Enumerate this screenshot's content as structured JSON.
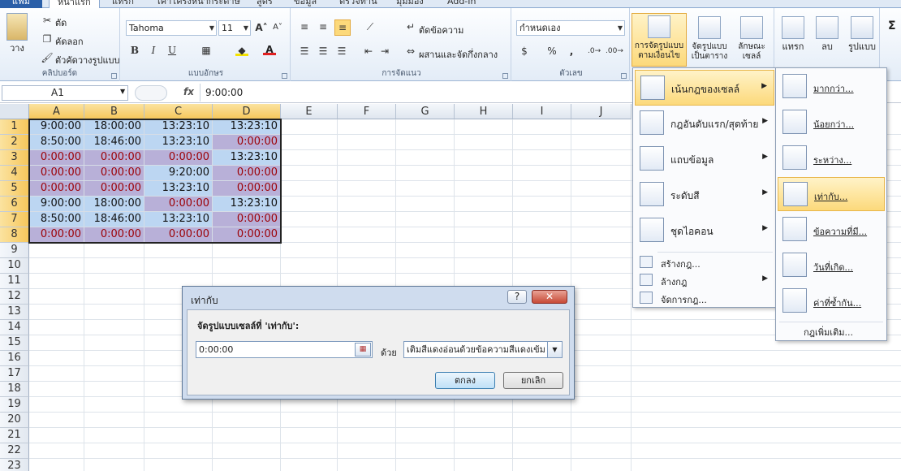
{
  "tabs": {
    "file": "แฟ้ม",
    "home": "หน้าแรก",
    "insert": "แทรก",
    "page_layout": "เค้าโครงหน้ากระดาษ",
    "formulas": "สูตร",
    "data": "ข้อมูล",
    "review": "ตรวจทาน",
    "view": "มุมมอง",
    "addins": "Add-In"
  },
  "ribbon": {
    "clipboard": {
      "title": "คลิปบอร์ด",
      "paste_label": "วาง",
      "cut": "ตัด",
      "copy": "คัดลอก",
      "format_painter": "ตัวคัดวางรูปแบบ"
    },
    "font": {
      "title": "แบบอักษร",
      "font_name": "Tahoma",
      "font_size": "11",
      "bold": "B",
      "italic": "I",
      "underline": "U",
      "font_color_letter": "A"
    },
    "alignment": {
      "title": "การจัดแนว",
      "wrap_text": "ตัดข้อความ",
      "merge_center": "ผสานและจัดกึ่งกลาง"
    },
    "number": {
      "title": "ตัวเลข",
      "format": "กำหนดเอง",
      "percent": "%",
      "comma": ","
    },
    "styles": {
      "conditional_formatting": "การจัดรูปแบบตามเงื่อนไข",
      "format_as_table": "จัดรูปแบบเป็นตาราง",
      "cell_styles": "ลักษณะเซลล์"
    },
    "cells": {
      "insert": "แทรก",
      "delete": "ลบ",
      "format": "รูปแบบ"
    },
    "editing": {
      "sum": "Σ"
    }
  },
  "formula_bar": {
    "name_box": "A1",
    "fx": "fx",
    "formula": "9:00:00"
  },
  "columns": [
    "A",
    "B",
    "C",
    "D",
    "E",
    "F",
    "G",
    "H",
    "I",
    "J"
  ],
  "rows": [
    "1",
    "2",
    "3",
    "4",
    "5",
    "6",
    "7",
    "8",
    "9",
    "10",
    "11",
    "12",
    "13",
    "14",
    "15",
    "16",
    "17",
    "18",
    "19",
    "20",
    "21",
    "22",
    "23"
  ],
  "cells": [
    [
      {
        "v": "9:00:00",
        "red": false
      },
      {
        "v": "18:00:00",
        "red": false
      },
      {
        "v": "13:23:10",
        "red": false
      },
      {
        "v": "13:23:10",
        "red": false
      }
    ],
    [
      {
        "v": "8:50:00",
        "red": false
      },
      {
        "v": "18:46:00",
        "red": false
      },
      {
        "v": "13:23:10",
        "red": false
      },
      {
        "v": "0:00:00",
        "red": true
      }
    ],
    [
      {
        "v": "0:00:00",
        "red": true
      },
      {
        "v": "0:00:00",
        "red": true
      },
      {
        "v": "0:00:00",
        "red": true
      },
      {
        "v": "13:23:10",
        "red": false
      }
    ],
    [
      {
        "v": "0:00:00",
        "red": true
      },
      {
        "v": "0:00:00",
        "red": true
      },
      {
        "v": "9:20:00",
        "red": false
      },
      {
        "v": "0:00:00",
        "red": true
      }
    ],
    [
      {
        "v": "0:00:00",
        "red": true
      },
      {
        "v": "0:00:00",
        "red": true
      },
      {
        "v": "13:23:10",
        "red": false
      },
      {
        "v": "0:00:00",
        "red": true
      }
    ],
    [
      {
        "v": "9:00:00",
        "red": false
      },
      {
        "v": "18:00:00",
        "red": false
      },
      {
        "v": "0:00:00",
        "red": true
      },
      {
        "v": "13:23:10",
        "red": false
      }
    ],
    [
      {
        "v": "8:50:00",
        "red": false
      },
      {
        "v": "18:46:00",
        "red": false
      },
      {
        "v": "13:23:10",
        "red": false
      },
      {
        "v": "0:00:00",
        "red": true
      }
    ],
    [
      {
        "v": "0:00:00",
        "red": true
      },
      {
        "v": "0:00:00",
        "red": true
      },
      {
        "v": "0:00:00",
        "red": true
      },
      {
        "v": "0:00:00",
        "red": true
      }
    ]
  ],
  "cf_menu": {
    "items": [
      {
        "label": "เน้นกฎของเซลล์",
        "icon": "highlight-cells-icon"
      },
      {
        "label": "กฎอันดับแรก/สุดท้าย",
        "icon": "top-bottom-icon"
      },
      {
        "label": "แถบข้อมูล",
        "icon": "data-bars-icon"
      },
      {
        "label": "ระดับสี",
        "icon": "color-scales-icon"
      },
      {
        "label": "ชุดไอคอน",
        "icon": "icon-sets-icon"
      }
    ],
    "new_rule": "สร้างกฎ...",
    "clear_rules": "ล้างกฎ",
    "manage_rules": "จัดการกฎ..."
  },
  "submenu": {
    "items": [
      {
        "label": "มากกว่า...",
        "icon": "greater-than-icon"
      },
      {
        "label": "น้อยกว่า...",
        "icon": "less-than-icon"
      },
      {
        "label": "ระหว่าง...",
        "icon": "between-icon"
      },
      {
        "label": "เท่ากับ...",
        "icon": "equal-to-icon"
      },
      {
        "label": "ข้อความที่มี...",
        "icon": "text-contains-icon"
      },
      {
        "label": "วันที่เกิด...",
        "icon": "date-occurring-icon"
      },
      {
        "label": "ค่าที่ซ้ำกัน...",
        "icon": "duplicate-values-icon"
      }
    ],
    "more_rules": "กฎเพิ่มเติม..."
  },
  "dialog": {
    "title": "เท่ากับ",
    "help": "?",
    "close": "✕",
    "label": "จัดรูปแบบเซลล์ที่ 'เท่ากับ':",
    "value": "0:00:00",
    "with_label": "ด้วย",
    "format_option": "เติมสีแดงอ่อนด้วยข้อความสีแดงเข้ม",
    "ok": "ตกลง",
    "cancel": "ยกเลิก"
  },
  "colors": {
    "selection_fill": "#bcd6f2",
    "rule_fill": "#b8b0d8",
    "rule_text": "#9c0006",
    "accent": "#fcd97b"
  }
}
